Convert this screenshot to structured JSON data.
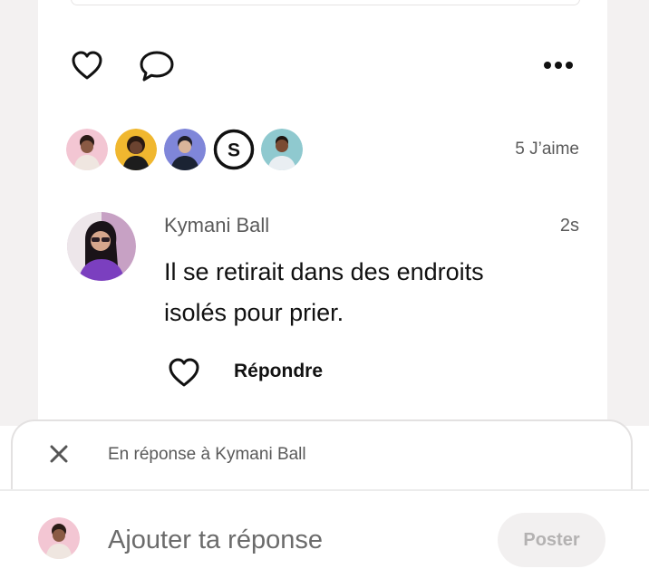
{
  "actions": {
    "like_icon": "heart-outline-icon",
    "comment_icon": "speech-bubble-icon",
    "more_icon": "more-horizontal-icon"
  },
  "likes": {
    "liker_avatars": [
      "avatar-pink",
      "avatar-yellow",
      "avatar-blue",
      "avatar-initial",
      "avatar-teal"
    ],
    "liker_initial": "S",
    "count_label": "5 J’aime"
  },
  "comment": {
    "author": "Kymani Ball",
    "time": "2s",
    "text": "Il se retirait dans des endroits isolés pour prier.",
    "reply_label": "Répondre",
    "like_icon": "heart-outline-icon"
  },
  "reply_banner": {
    "close_icon": "close-icon",
    "text": "En réponse à Kymani Ball"
  },
  "composer": {
    "placeholder": "Ajouter ta réponse",
    "value": "",
    "post_label": "Poster"
  },
  "colors": {
    "background_side": "#f3f1f1",
    "text_primary": "#111111",
    "text_secondary": "#5a5a5a",
    "button_disabled_bg": "#f2f0f0",
    "button_disabled_text": "#b4b2b2"
  }
}
